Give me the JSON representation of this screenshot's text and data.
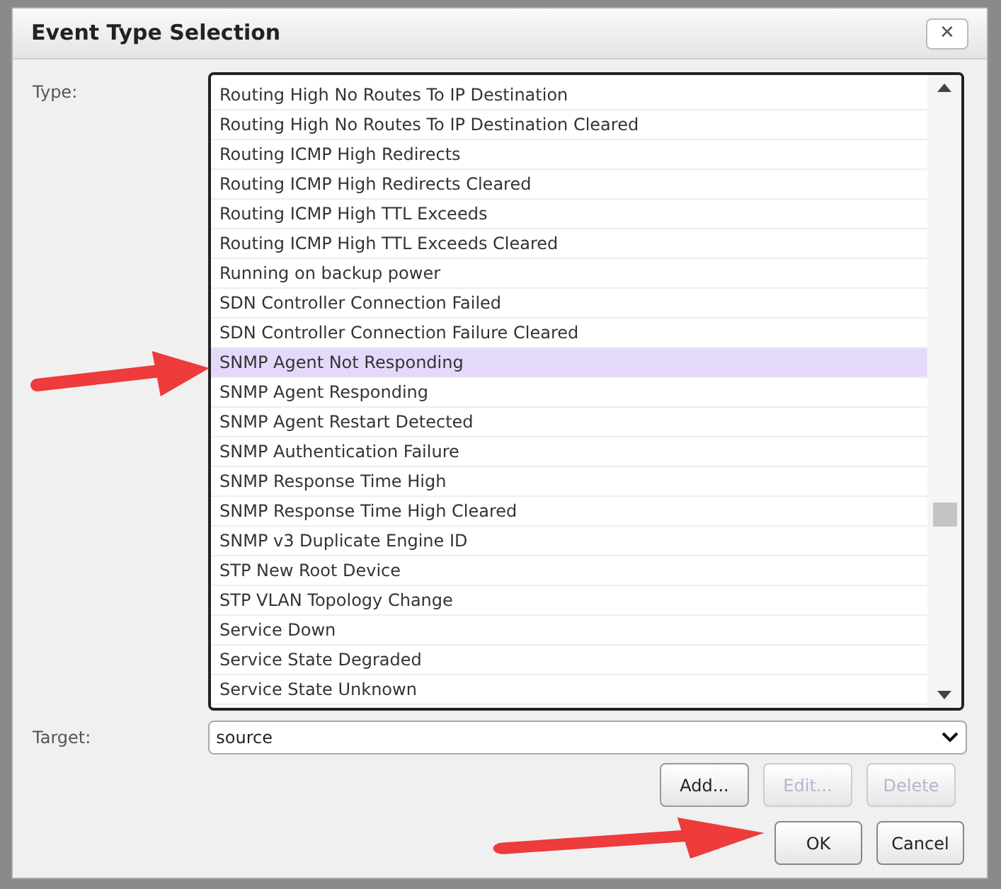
{
  "dialog": {
    "title": "Event Type Selection",
    "close_label": "✕"
  },
  "type_field": {
    "label": "Type:",
    "items": [
      {
        "label": "Routing High No Routes To IP Destination",
        "selected": false
      },
      {
        "label": "Routing High No Routes To IP Destination Cleared",
        "selected": false
      },
      {
        "label": "Routing ICMP High Redirects",
        "selected": false
      },
      {
        "label": "Routing ICMP High Redirects Cleared",
        "selected": false
      },
      {
        "label": "Routing ICMP High TTL Exceeds",
        "selected": false
      },
      {
        "label": "Routing ICMP High TTL Exceeds Cleared",
        "selected": false
      },
      {
        "label": "Running on backup power",
        "selected": false
      },
      {
        "label": "SDN Controller Connection Failed",
        "selected": false
      },
      {
        "label": "SDN Controller Connection Failure Cleared",
        "selected": false
      },
      {
        "label": "SNMP Agent Not Responding",
        "selected": true
      },
      {
        "label": "SNMP Agent Responding",
        "selected": false
      },
      {
        "label": "SNMP Agent Restart Detected",
        "selected": false
      },
      {
        "label": "SNMP Authentication Failure",
        "selected": false
      },
      {
        "label": "SNMP Response Time High",
        "selected": false
      },
      {
        "label": "SNMP Response Time High Cleared",
        "selected": false
      },
      {
        "label": "SNMP v3 Duplicate Engine ID",
        "selected": false
      },
      {
        "label": "STP New Root Device",
        "selected": false
      },
      {
        "label": "STP VLAN Topology Change",
        "selected": false
      },
      {
        "label": "Service Down",
        "selected": false
      },
      {
        "label": "Service State Degraded",
        "selected": false
      },
      {
        "label": "Service State Unknown",
        "selected": false
      }
    ]
  },
  "target_field": {
    "label": "Target:",
    "value": "source"
  },
  "target_buttons": [
    {
      "label": "Add...",
      "disabled": false
    },
    {
      "label": "Edit...",
      "disabled": true
    },
    {
      "label": "Delete",
      "disabled": true
    }
  ],
  "footer_buttons": [
    {
      "label": "OK"
    },
    {
      "label": "Cancel"
    }
  ]
}
